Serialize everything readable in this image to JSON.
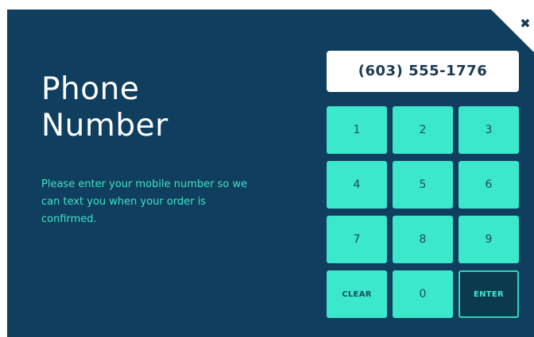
{
  "dialog": {
    "title_line1": "Phone",
    "title_line2": "Number",
    "description": "Please enter your mobile number so we can text you when your order is confirmed.",
    "close_icon": "close-icon",
    "close_glyph": "✖"
  },
  "phone": {
    "value": "(603) 555-1776"
  },
  "keypad": {
    "keys": [
      "1",
      "2",
      "3",
      "4",
      "5",
      "6",
      "7",
      "8",
      "9",
      "CLEAR",
      "0",
      "ENTER"
    ]
  },
  "colors": {
    "background": "#0f3e5e",
    "accent": "#3ce8cc",
    "text": "#ffffff"
  }
}
